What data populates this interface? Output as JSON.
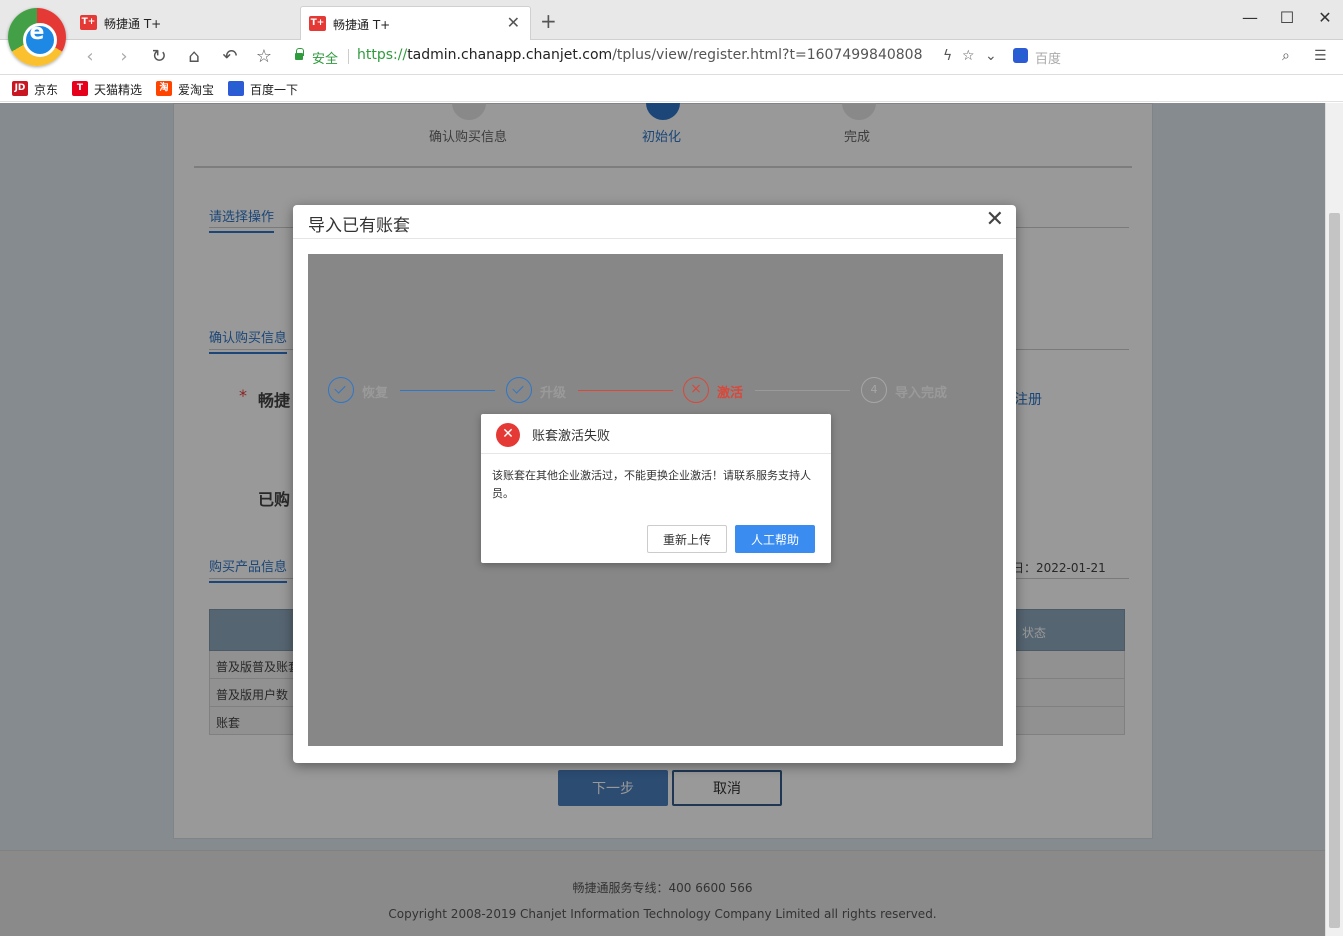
{
  "browser": {
    "tabs": [
      {
        "title": "畅捷通 T+",
        "favicon": "T+",
        "active": false
      },
      {
        "title": "畅捷通 T+",
        "favicon": "T+",
        "active": true
      }
    ],
    "secure_label": "安全",
    "url": {
      "scheme": "https://",
      "host": "tadmin.chanapp.chanjet.com",
      "path": "/tplus/view/register.html?t=1607499840808"
    },
    "search_placeholder": "百度",
    "bookmarks": [
      {
        "label": "京东",
        "icon": "JD",
        "color": "#c81623"
      },
      {
        "label": "天猫精选",
        "icon": "T",
        "color": "#e5001c"
      },
      {
        "label": "爱淘宝",
        "icon": "淘",
        "color": "#ff4400"
      },
      {
        "label": "百度一下",
        "icon": "paw-icon",
        "color": "#2d5bd6"
      }
    ]
  },
  "page": {
    "steps": [
      "确认购买信息",
      "初始化",
      "完成"
    ],
    "active_step": "初始化",
    "section_select": "请选择操作",
    "section_confirm": "确认购买信息",
    "field_product": "畅捷",
    "field_bought": "已购",
    "register_link": "注册",
    "section_products": "购买产品信息",
    "expire_text": "日：2022-01-21",
    "table": {
      "header_status": "状态",
      "rows": [
        "普及版普及账套",
        "普及版用户数",
        "账套"
      ]
    },
    "next_button": "下一步",
    "cancel_button": "取消",
    "footer_hotline": "畅捷通服务专线：400 6600 566",
    "footer_copyright": "Copyright 2008-2019 Chanjet Information Technology Company Limited all rights reserved."
  },
  "modal": {
    "title": "导入已有账套",
    "wizard": [
      {
        "label": "恢复",
        "state": "done"
      },
      {
        "label": "升级",
        "state": "done"
      },
      {
        "label": "激活",
        "state": "error"
      },
      {
        "label": "导入完成",
        "state": "todo",
        "number": "4"
      }
    ]
  },
  "alert": {
    "title": "账套激活失败",
    "message": "该账套在其他企业激活过，不能更换企业激活！请联系服务支持人员。",
    "retry_button": "重新上传",
    "help_button": "人工帮助"
  },
  "colors": {
    "accent": "#2f76c8",
    "error": "#e53935",
    "primary_button": "#3b8cf0"
  }
}
